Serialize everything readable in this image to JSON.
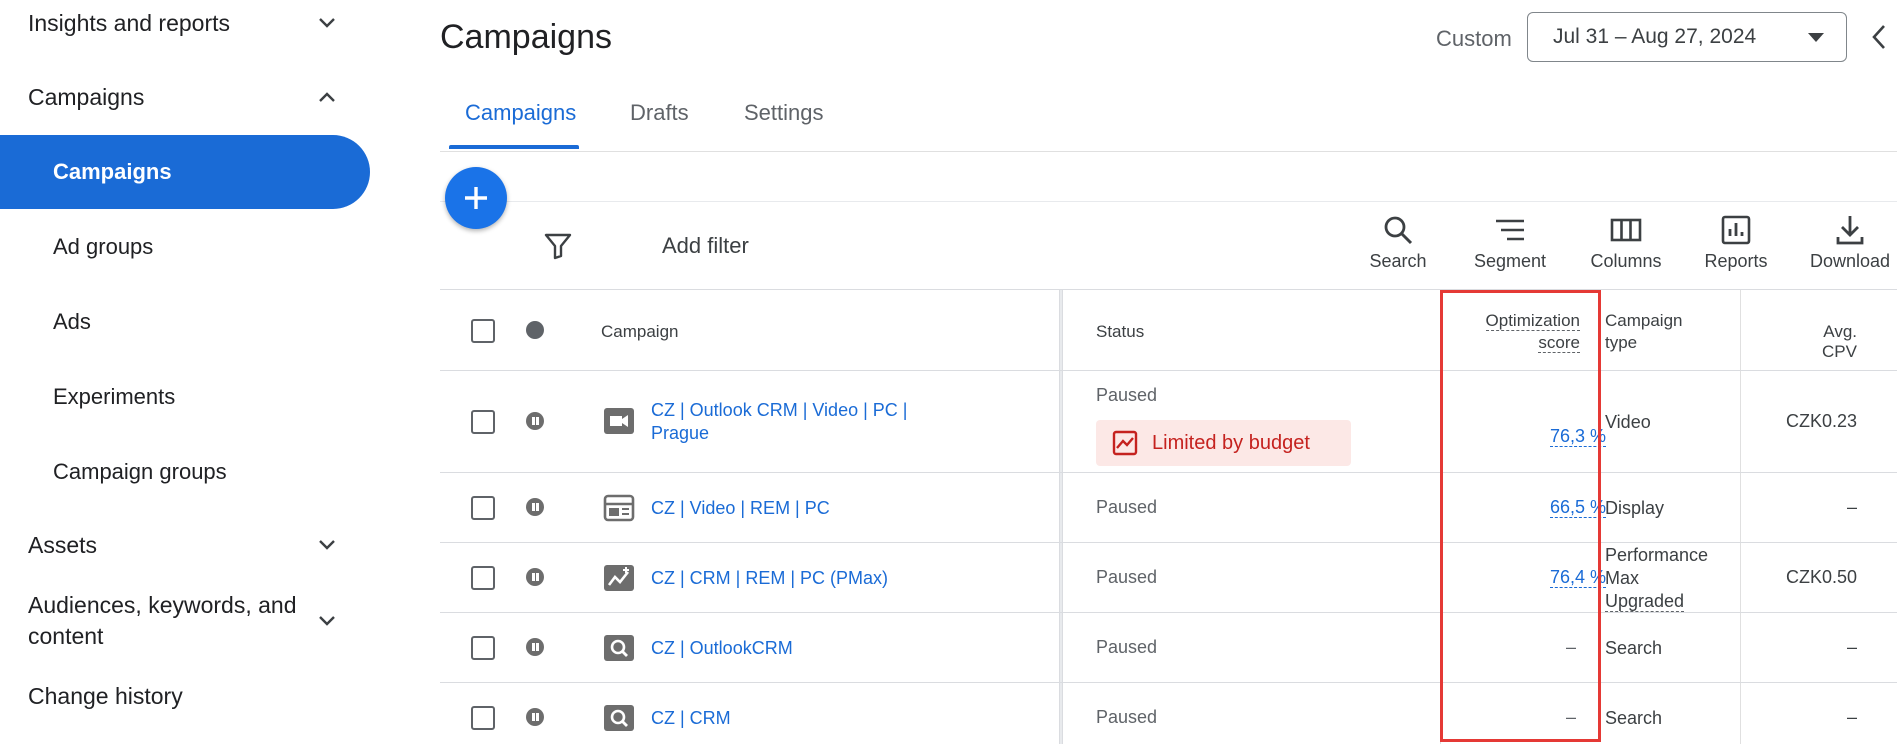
{
  "sidebar": {
    "insights": "Insights and reports",
    "campaigns_section": "Campaigns",
    "sub_items": [
      "Campaigns",
      "Ad groups",
      "Ads",
      "Experiments",
      "Campaign groups"
    ],
    "assets": "Assets",
    "audiences": "Audiences, keywords, and content",
    "change_history": "Change history"
  },
  "header": {
    "title": "Campaigns",
    "date_label": "Custom",
    "date_range": "Jul 31 – Aug 27, 2024"
  },
  "tabs": [
    "Campaigns",
    "Drafts",
    "Settings"
  ],
  "toolbar": {
    "add_filter": "Add filter",
    "tools": [
      "Search",
      "Segment",
      "Columns",
      "Reports",
      "Download"
    ]
  },
  "table": {
    "headers": {
      "campaign": "Campaign",
      "status": "Status",
      "opt_score_1": "Optimization",
      "opt_score_2": "score",
      "campaign_type_1": "Campaign",
      "campaign_type_2": "type",
      "avg_cpv": "Avg. CPV"
    },
    "budget_chip": "Limited by budget",
    "rows": [
      {
        "name_1": "CZ | Outlook CRM | Video | PC |",
        "name_2": "Prague",
        "icon": "video-icon",
        "status": "Paused",
        "opt": "76,3 %",
        "type_1": "Video",
        "type_2": "",
        "type_3": "",
        "cpv": "CZK0.23"
      },
      {
        "name_1": "CZ | Video | REM | PC",
        "name_2": "",
        "icon": "display-icon",
        "status": "Paused",
        "opt": "66,5 %",
        "type_1": "Display",
        "type_2": "",
        "type_3": "",
        "cpv": "–"
      },
      {
        "name_1": "CZ | CRM | REM | PC (PMax)",
        "name_2": "",
        "icon": "pmax-icon",
        "status": "Paused",
        "opt": "76,4 %",
        "type_1": "Performance",
        "type_2": "Max",
        "type_3": "Upgraded",
        "cpv": "CZK0.50"
      },
      {
        "name_1": "CZ | OutlookCRM",
        "name_2": "",
        "icon": "search-campaign-icon",
        "status": "Paused",
        "opt": "–",
        "type_1": "Search",
        "type_2": "",
        "type_3": "",
        "cpv": "–"
      },
      {
        "name_1": "CZ | CRM",
        "name_2": "",
        "icon": "search-campaign-icon",
        "status": "Paused",
        "opt": "–",
        "type_1": "Search",
        "type_2": "",
        "type_3": "",
        "cpv": "–"
      }
    ]
  },
  "colors": {
    "accent": "#1a6bd6",
    "highlight": "#e53935",
    "budget_bg": "#fce8e6",
    "budget_text": "#c5221f"
  }
}
